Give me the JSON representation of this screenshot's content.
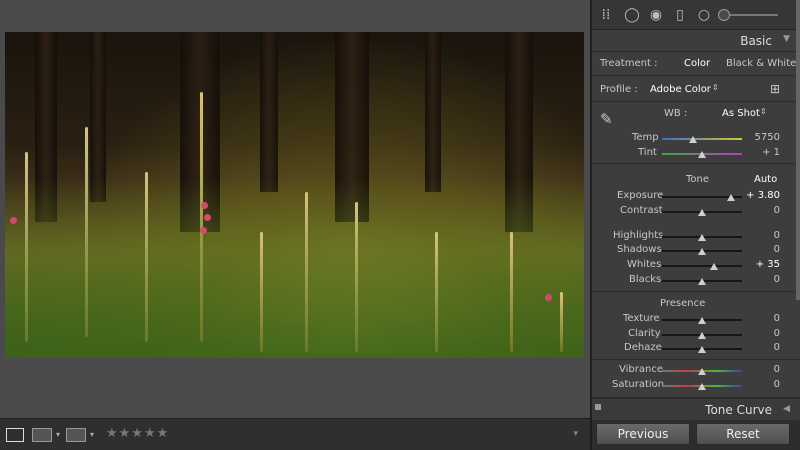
{
  "basic": {
    "title": "Basic",
    "treatment_label": "Treatment :",
    "treatment_color": "Color",
    "treatment_bw": "Black & White",
    "profile_label": "Profile :",
    "profile_value": "Adobe Color",
    "wb_label": "WB :",
    "wb_value": "As Shot",
    "temp_label": "Temp",
    "temp_value": "5750",
    "tint_label": "Tint",
    "tint_value": "+ 1",
    "tone_label": "Tone",
    "auto_label": "Auto",
    "exposure_label": "Exposure",
    "exposure_value": "+ 3.80",
    "contrast_label": "Contrast",
    "contrast_value": "0",
    "highlights_label": "Highlights",
    "highlights_value": "0",
    "shadows_label": "Shadows",
    "shadows_value": "0",
    "whites_label": "Whites",
    "whites_value": "+ 35",
    "blacks_label": "Blacks",
    "blacks_value": "0",
    "presence_label": "Presence",
    "texture_label": "Texture",
    "texture_value": "0",
    "clarity_label": "Clarity",
    "clarity_value": "0",
    "dehaze_label": "Dehaze",
    "dehaze_value": "0",
    "vibrance_label": "Vibrance",
    "vibrance_value": "0",
    "saturation_label": "Saturation",
    "saturation_value": "0"
  },
  "tone_curve": {
    "title": "Tone Curve"
  },
  "footer": {
    "previous": "Previous",
    "reset": "Reset"
  },
  "toolbar": {
    "stars": "★★★★★"
  },
  "icons": {
    "tools": [
      "grid-icon",
      "crop-circle-icon",
      "spot-removal-icon",
      "brush-icon",
      "radial-icon"
    ]
  }
}
